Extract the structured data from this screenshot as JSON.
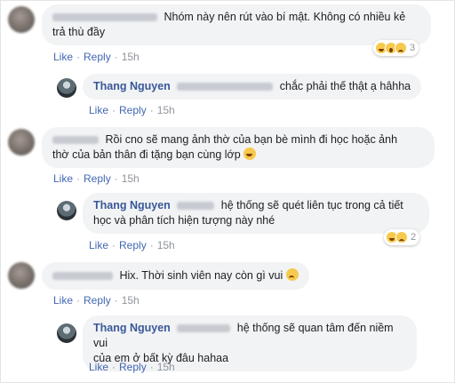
{
  "actions": {
    "like": "Like",
    "reply": "Reply",
    "dot": "·"
  },
  "comments": [
    {
      "id": "c1",
      "text_line1": "Nhóm này nên rút vào bí mật. Không có nhiều kẻ",
      "text_line2": "trả thù đầy",
      "time": "15h",
      "reaction_count": "3",
      "reactions": [
        "haha-icon",
        "wow-icon",
        "sad-icon"
      ]
    },
    {
      "id": "r1",
      "author": "Thang Nguyen",
      "text": "chắc phải thế thật ạ hâhha",
      "time": "15h"
    },
    {
      "id": "c2",
      "text_line1": "Rồi cno sẽ mang ảnh thờ của bạn bè mình đi học hoặc ảnh",
      "text_line2": "thờ của bản thân đi tặng bạn cùng lớp",
      "time": "15h"
    },
    {
      "id": "r2",
      "author": "Thang Nguyen",
      "text_line1": "hệ thống sẽ quét liên tục trong cả tiết",
      "text_line2": "học và phân tích hiện tượng này nhé",
      "time": "15h",
      "reaction_count": "2",
      "reactions": [
        "haha-icon",
        "sad-icon"
      ]
    },
    {
      "id": "c3",
      "text": "Hix. Thời sinh viên nay còn gì vui",
      "time": "15h"
    },
    {
      "id": "r3",
      "author": "Thang Nguyen",
      "text_line1": "hệ thống sẽ quan tâm đến niềm vui",
      "text_line2": "của em ở bất kỳ đâu hahaa",
      "time": "15h"
    }
  ],
  "colors": {
    "author": "#385898",
    "link": "#4267b2",
    "bubble": "#f2f3f5",
    "meta": "#90949c"
  }
}
